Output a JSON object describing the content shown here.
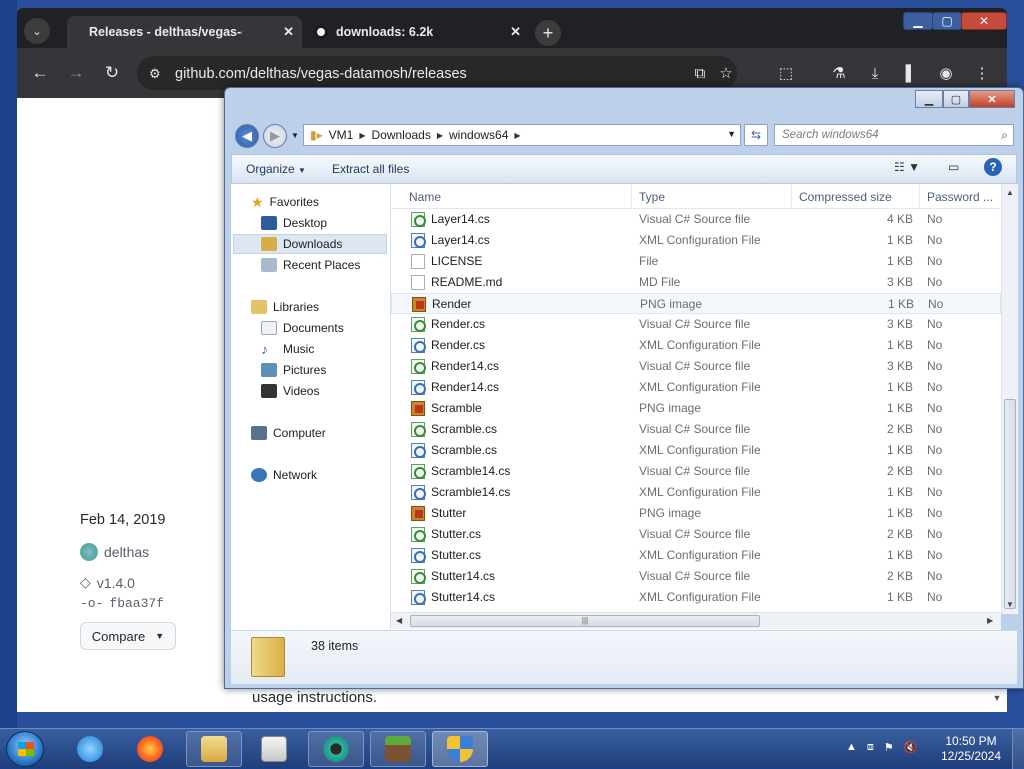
{
  "browser": {
    "tabs": [
      {
        "label": "Releases - delthas/vegas-datamosh",
        "active": true
      },
      {
        "label": "downloads: 6.2k",
        "active": false
      }
    ],
    "url": "github.com/delthas/vegas-datamosh/releases",
    "window_controls": [
      "minimize",
      "maximize",
      "close"
    ]
  },
  "github_page": {
    "date": "Feb 14, 2019",
    "author": "delthas",
    "tag": "v1.4.0",
    "commit": "fbaa37f",
    "compare_label": "Compare",
    "body_text": "usage instructions."
  },
  "explorer": {
    "breadcrumb": [
      "VM1",
      "Downloads",
      "windows64"
    ],
    "search_placeholder": "Search windows64",
    "commands": {
      "organize": "Organize",
      "extract": "Extract all files"
    },
    "nav": {
      "favorites": "Favorites",
      "desktop": "Desktop",
      "downloads": "Downloads",
      "recent": "Recent Places",
      "libraries": "Libraries",
      "documents": "Documents",
      "music": "Music",
      "pictures": "Pictures",
      "videos": "Videos",
      "computer": "Computer",
      "network": "Network"
    },
    "columns": {
      "name": "Name",
      "type": "Type",
      "size": "Compressed size",
      "password": "Password ..."
    },
    "files": [
      {
        "name": "Layer14.cs",
        "type": "Visual C# Source file",
        "size": "4 KB",
        "password": "No",
        "icon": "cs"
      },
      {
        "name": "Layer14.cs",
        "type": "XML Configuration File",
        "size": "1 KB",
        "password": "No",
        "icon": "xml"
      },
      {
        "name": "LICENSE",
        "type": "File",
        "size": "1 KB",
        "password": "No",
        "icon": "txt"
      },
      {
        "name": "README.md",
        "type": "MD File",
        "size": "3 KB",
        "password": "No",
        "icon": "txt"
      },
      {
        "name": "Render",
        "type": "PNG image",
        "size": "1 KB",
        "password": "No",
        "icon": "png"
      },
      {
        "name": "Render.cs",
        "type": "Visual C# Source file",
        "size": "3 KB",
        "password": "No",
        "icon": "cs"
      },
      {
        "name": "Render.cs",
        "type": "XML Configuration File",
        "size": "1 KB",
        "password": "No",
        "icon": "xml"
      },
      {
        "name": "Render14.cs",
        "type": "Visual C# Source file",
        "size": "3 KB",
        "password": "No",
        "icon": "cs"
      },
      {
        "name": "Render14.cs",
        "type": "XML Configuration File",
        "size": "1 KB",
        "password": "No",
        "icon": "xml"
      },
      {
        "name": "Scramble",
        "type": "PNG image",
        "size": "1 KB",
        "password": "No",
        "icon": "png"
      },
      {
        "name": "Scramble.cs",
        "type": "Visual C# Source file",
        "size": "2 KB",
        "password": "No",
        "icon": "cs"
      },
      {
        "name": "Scramble.cs",
        "type": "XML Configuration File",
        "size": "1 KB",
        "password": "No",
        "icon": "xml"
      },
      {
        "name": "Scramble14.cs",
        "type": "Visual C# Source file",
        "size": "2 KB",
        "password": "No",
        "icon": "cs"
      },
      {
        "name": "Scramble14.cs",
        "type": "XML Configuration File",
        "size": "1 KB",
        "password": "No",
        "icon": "xml"
      },
      {
        "name": "Stutter",
        "type": "PNG image",
        "size": "1 KB",
        "password": "No",
        "icon": "png"
      },
      {
        "name": "Stutter.cs",
        "type": "Visual C# Source file",
        "size": "2 KB",
        "password": "No",
        "icon": "cs"
      },
      {
        "name": "Stutter.cs",
        "type": "XML Configuration File",
        "size": "1 KB",
        "password": "No",
        "icon": "xml"
      },
      {
        "name": "Stutter14.cs",
        "type": "Visual C# Source file",
        "size": "2 KB",
        "password": "No",
        "icon": "cs"
      },
      {
        "name": "Stutter14.cs",
        "type": "XML Configuration File",
        "size": "1 KB",
        "password": "No",
        "icon": "xml"
      }
    ],
    "item_count": "38 items"
  },
  "taskbar": {
    "time": "10:50 PM",
    "date": "12/25/2024"
  }
}
